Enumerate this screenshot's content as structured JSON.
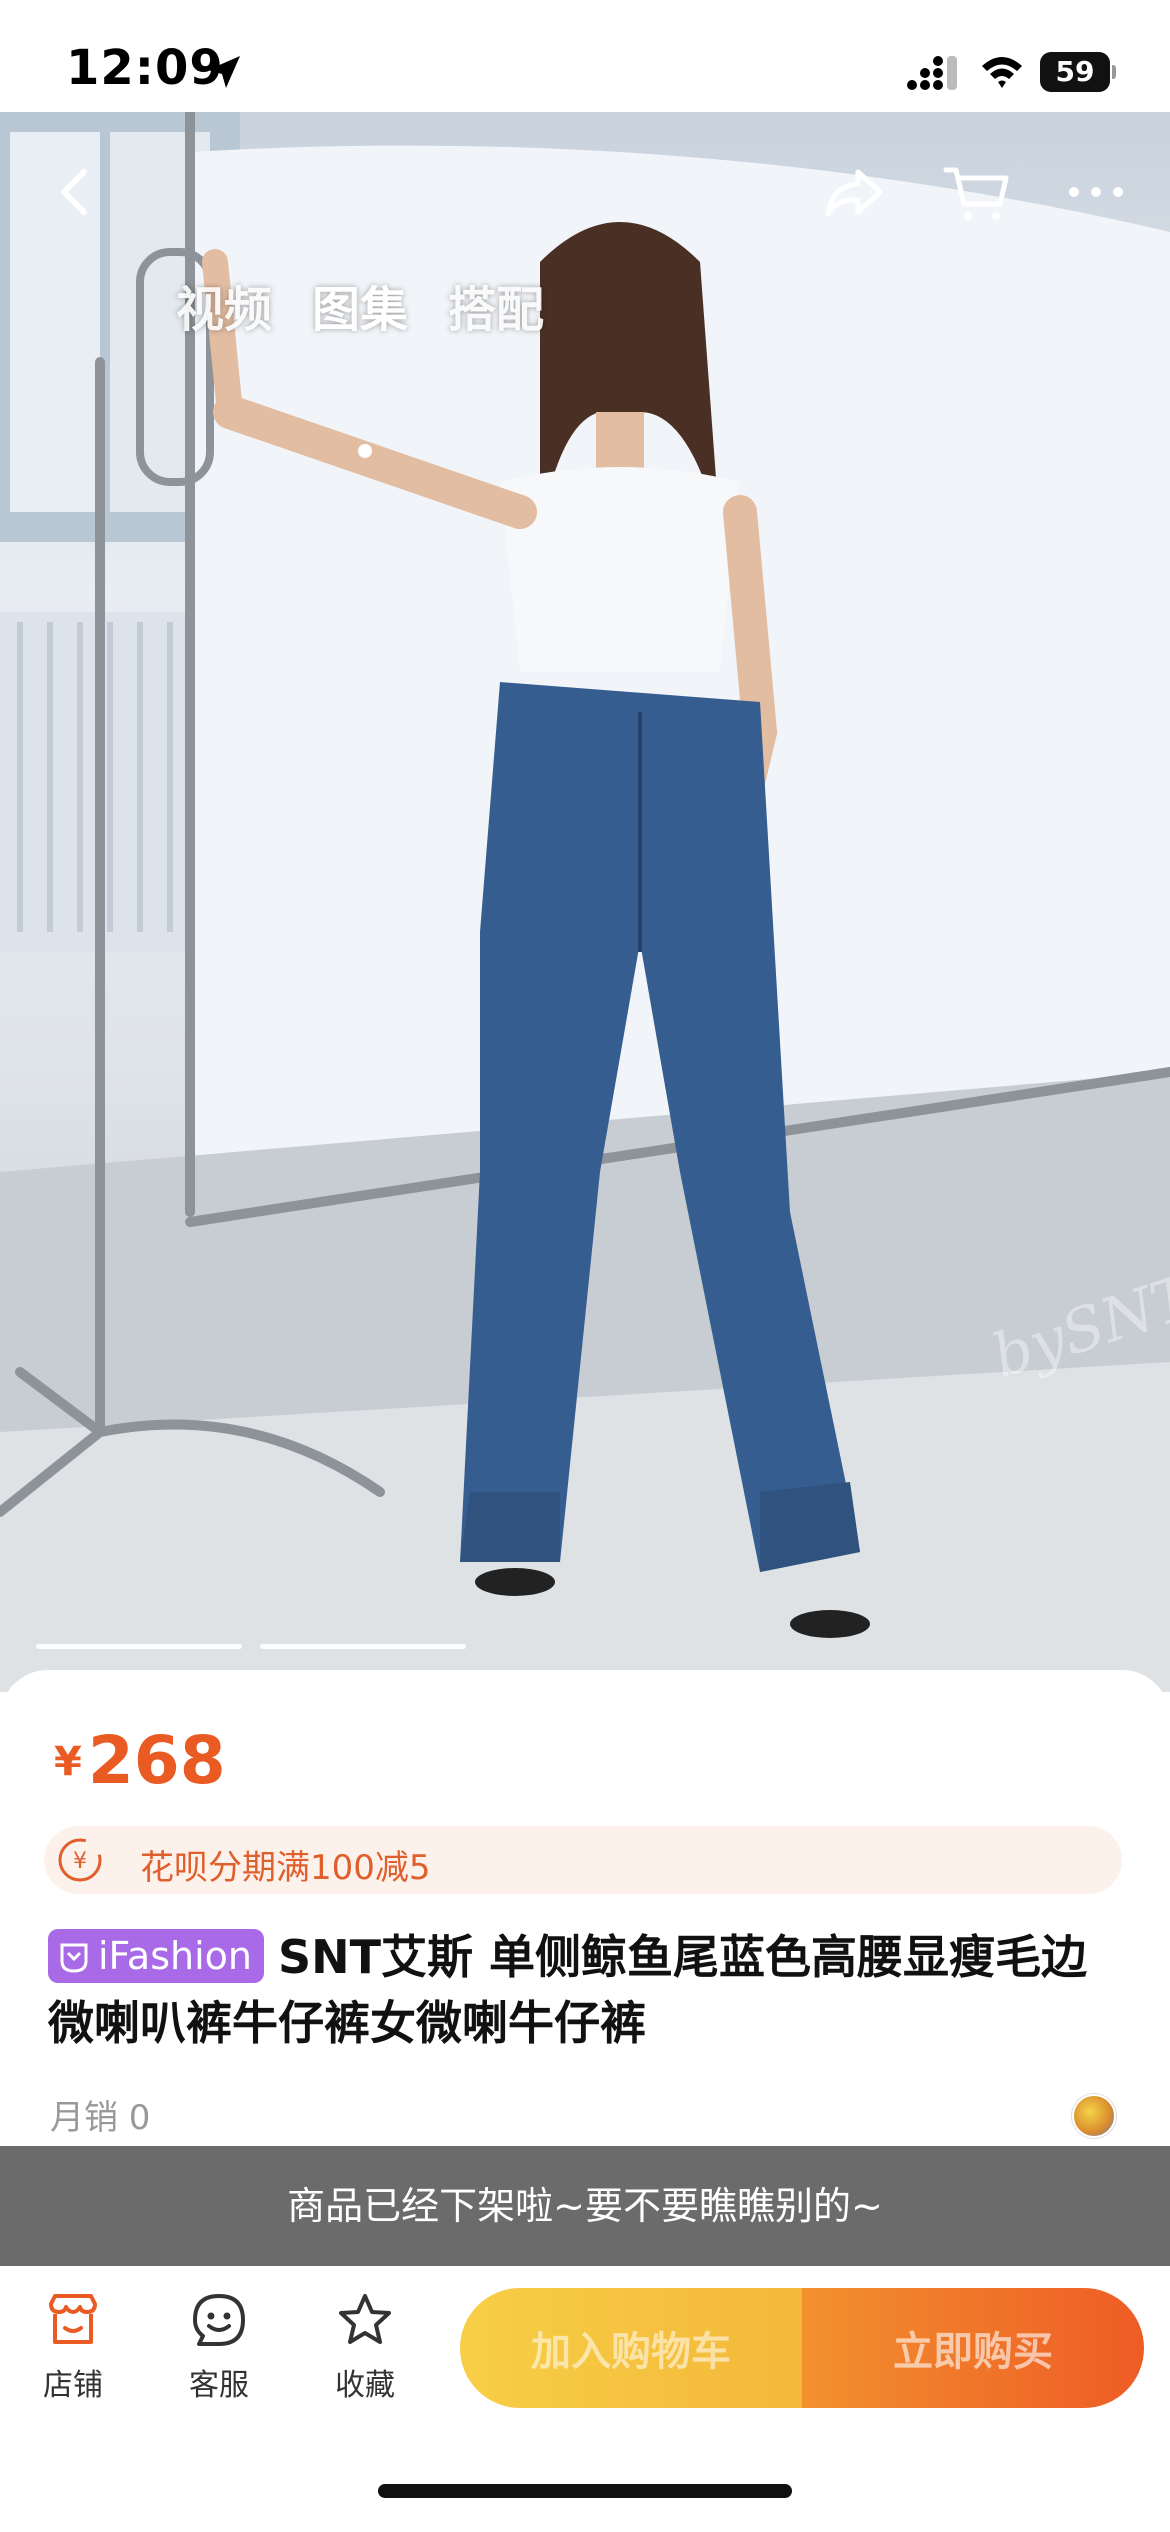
{
  "status_bar": {
    "time": "12:09",
    "battery": "59"
  },
  "gallery": {
    "tabs": [
      {
        "label": "视频"
      },
      {
        "label": "图集"
      },
      {
        "label": "搭配"
      }
    ],
    "active_tab": "图集",
    "watermark": "bySNT",
    "page_count": 2,
    "active_page": 2
  },
  "product": {
    "currency_symbol": "¥",
    "price": "268",
    "installment_text": "花呗分期满100减5",
    "badge": "iFashion",
    "title": "SNT艾斯 单侧鲸鱼尾蓝色高腰显瘦毛边微喇叭裤牛仔裤女微喇牛仔裤",
    "monthly_sales": "月销 0"
  },
  "notice": {
    "delisted": "商品已经下架啦~要不要瞧瞧别的~"
  },
  "action_bar": {
    "shop_label": "店铺",
    "service_label": "客服",
    "favorite_label": "收藏",
    "add_to_cart_label": "加入购物车",
    "buy_now_label": "立即购买"
  },
  "colors": {
    "price": "#ea5b24",
    "badge": "#a86ae6",
    "cart_button": "#f4b73a",
    "buy_button": "#ee5c25",
    "banner": "#6b6b6b"
  }
}
